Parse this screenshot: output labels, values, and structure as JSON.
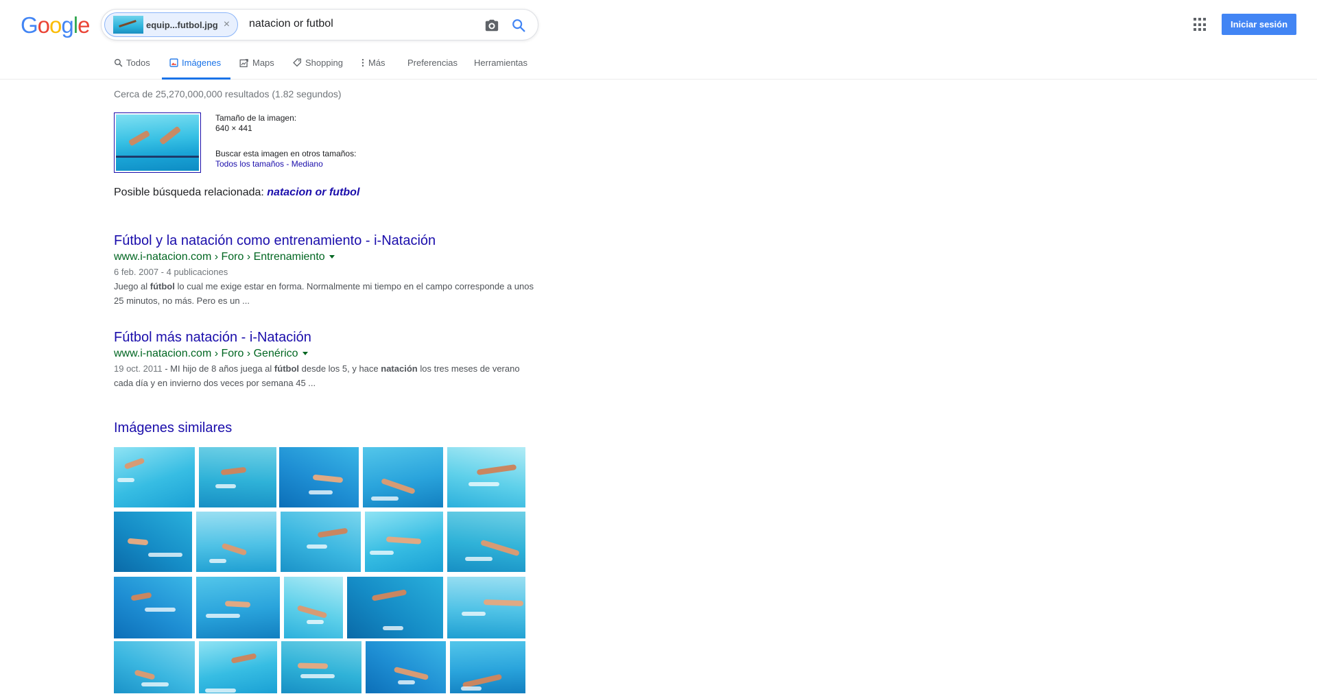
{
  "header": {
    "logo_letters": [
      {
        "char": "G",
        "color": "#4285f4"
      },
      {
        "char": "o",
        "color": "#ea4335"
      },
      {
        "char": "o",
        "color": "#fbbc05"
      },
      {
        "char": "g",
        "color": "#4285f4"
      },
      {
        "char": "l",
        "color": "#34a853"
      },
      {
        "char": "e",
        "color": "#ea4335"
      }
    ],
    "image_chip_name": "equip...futbol.jpg",
    "image_chip_close": "×",
    "query": "natacion or futbol",
    "camera_icon": "camera-icon",
    "search_icon": "search-icon",
    "apps_icon": "apps-grid-icon",
    "signin_label": "Iniciar sesión"
  },
  "tabs": {
    "todos": "Todos",
    "imagenes": "Imágenes",
    "maps": "Maps",
    "shopping": "Shopping",
    "mas": "Más",
    "preferencias": "Preferencias",
    "herramientas": "Herramientas",
    "active": "imagenes"
  },
  "results_info": {
    "stats": "Cerca de 25,270,000,000 resultados (1.82 segundos)"
  },
  "image_info": {
    "size_label": "Tamaño de la imagen:",
    "size_value": "640 × 441",
    "other_sizes_label": "Buscar esta imagen en otros tamaños:",
    "all_sizes": "Todos los tamaños",
    "separator": " - ",
    "medium": "Mediano"
  },
  "related": {
    "label": "Posible búsqueda relacionada: ",
    "query": "natacion or futbol"
  },
  "results": [
    {
      "title": "Fútbol y la natación como entrenamiento - i-Natación",
      "cite": "www.i-natacion.com › Foro › Entrenamiento",
      "date": "6 feb. 2007 - 4 publicaciones",
      "snippet_1": "Juego al ",
      "snippet_b1": "fútbol",
      "snippet_2": " lo cual me exige estar en forma. Normalmente mi tiempo en el campo corresponde a unos 25 minutos, no más. Pero es un ..."
    },
    {
      "title": "Fútbol más natación - i-Natación",
      "cite": "www.i-natacion.com › Foro › Genérico",
      "date": "19 oct. 2011",
      "snippet_1": " - MI hijo de 8 años juega al ",
      "snippet_b1": "fútbol",
      "snippet_2": " desde los 5, y hace ",
      "snippet_b2": "natación",
      "snippet_3": " los tres meses de verano cada día y en invierno dos veces por semana 45 ..."
    }
  ],
  "similar": {
    "heading": "Imágenes similares",
    "thumbnail_count": 20
  },
  "colors": {
    "link": "#1a0dab",
    "cite": "#006621",
    "accent": "#1a73e8",
    "signin": "#4285f4"
  }
}
